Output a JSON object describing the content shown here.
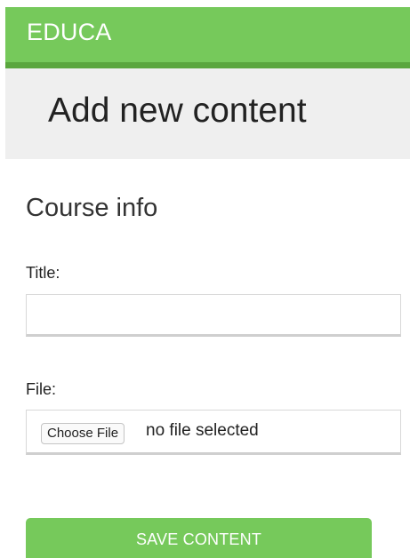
{
  "header": {
    "logo_text": "EDUCA",
    "accent_color": "#76c95b",
    "accent_dark": "#5aa63e"
  },
  "page": {
    "title": "Add new content"
  },
  "form": {
    "section_title": "Course info",
    "title_label": "Title:",
    "title_value": "",
    "file_label": "File:",
    "choose_file_label": "Choose File",
    "file_status": "no file selected",
    "submit_label": "SAVE CONTENT"
  }
}
